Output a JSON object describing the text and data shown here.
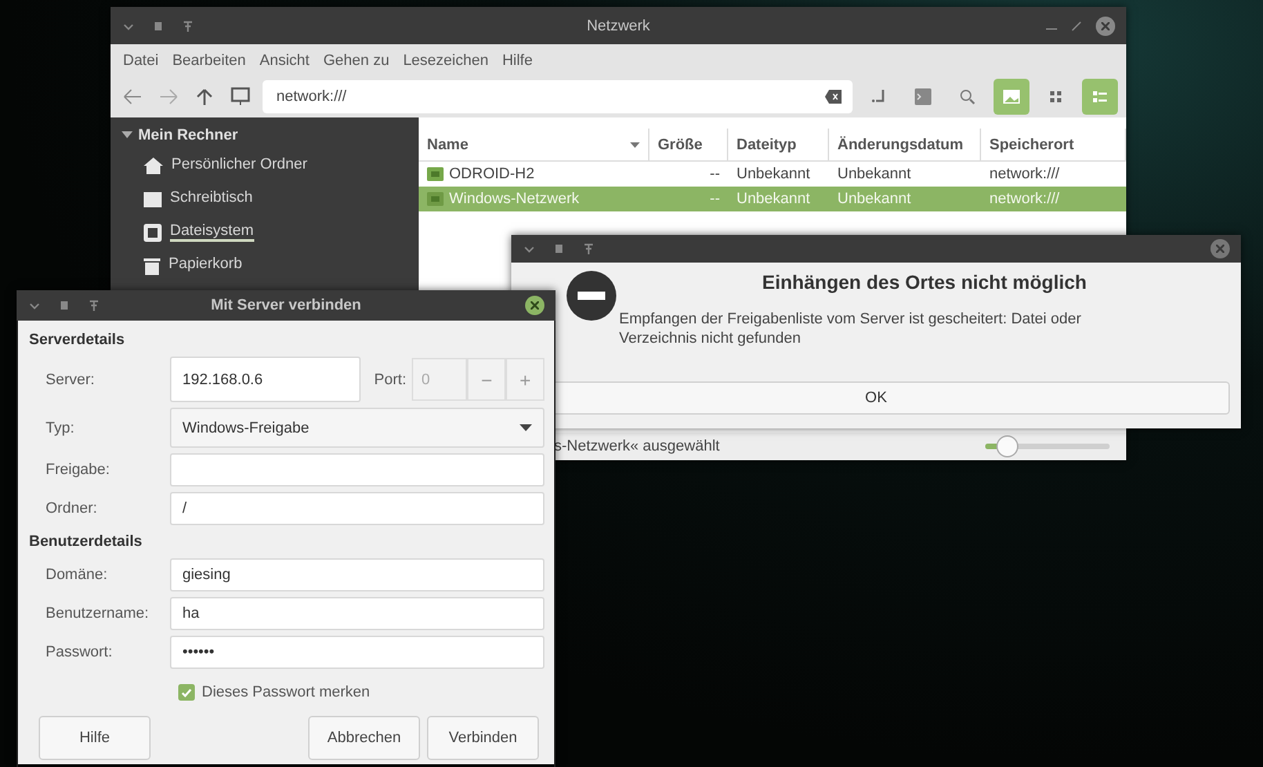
{
  "file_manager": {
    "title": "Netzwerk",
    "menu": [
      "Datei",
      "Bearbeiten",
      "Ansicht",
      "Gehen zu",
      "Lesezeichen",
      "Hilfe"
    ],
    "path": "network:///",
    "toolbar": {
      "thumbnails_on": true,
      "views": [
        {
          "kind": "icons",
          "selected": false
        },
        {
          "kind": "list",
          "selected": true
        }
      ]
    },
    "sidebar": {
      "label": "Mein Rechner",
      "expanded": true,
      "children": [
        {
          "label": "Persönlicher Ordner",
          "kind": "home",
          "focused": false
        },
        {
          "label": "Schreibtisch",
          "kind": "desktop",
          "focused": false
        },
        {
          "label": "Dateisystem",
          "kind": "drive",
          "focused": true
        },
        {
          "label": "Papierkorb",
          "kind": "trash",
          "focused": false
        }
      ]
    },
    "columns": [
      "Name",
      "Größe",
      "Dateityp",
      "Änderungsdatum",
      "Speicherort"
    ],
    "rows": [
      {
        "cells": [
          "ODROID-H2",
          "--",
          "Unbekannt",
          "Unbekannt",
          "network:///"
        ],
        "selected": false
      },
      {
        "cells": [
          "Windows-Netzwerk",
          "--",
          "Unbekannt",
          "Unbekannt",
          "network:///"
        ],
        "selected": true
      }
    ],
    "status": "s-Netzwerk« ausgewählt",
    "zoom": {
      "level": 0.18
    }
  },
  "error_dialog": {
    "title": "Einhängen des Ortes nicht möglich",
    "message": "Empfangen der Freigabenliste vom Server ist gescheitert: Datei oder Verzeichnis nicht gefunden",
    "button": "OK"
  },
  "connect_dialog": {
    "title": "Mit Server verbinden",
    "sections": [
      {
        "heading": "Serverdetails",
        "fields": [
          {
            "kind": "server",
            "label": "Server:",
            "value": "192.168.0.6",
            "port_label": "Port:",
            "port_value": "0",
            "port_disabled": true,
            "minus": "−",
            "plus": "+"
          },
          {
            "kind": "combo",
            "label": "Typ:",
            "value": "Windows-Freigabe"
          },
          {
            "kind": "text",
            "label": "Freigabe:"
          },
          {
            "kind": "text",
            "label": "Ordner:",
            "value": "/"
          }
        ]
      },
      {
        "heading": "Benutzerdetails",
        "fields": [
          {
            "kind": "text",
            "label": "Domäne:",
            "value": "giesing"
          },
          {
            "kind": "text",
            "label": "Benutzername:",
            "value": "ha"
          },
          {
            "kind": "password",
            "label": "Passwort:",
            "value": "••••••"
          }
        ]
      }
    ],
    "remember": {
      "label": "Dieses Passwort merken",
      "checked": true
    },
    "buttons": [
      "Hilfe",
      "Abbrechen",
      "Verbinden"
    ]
  }
}
